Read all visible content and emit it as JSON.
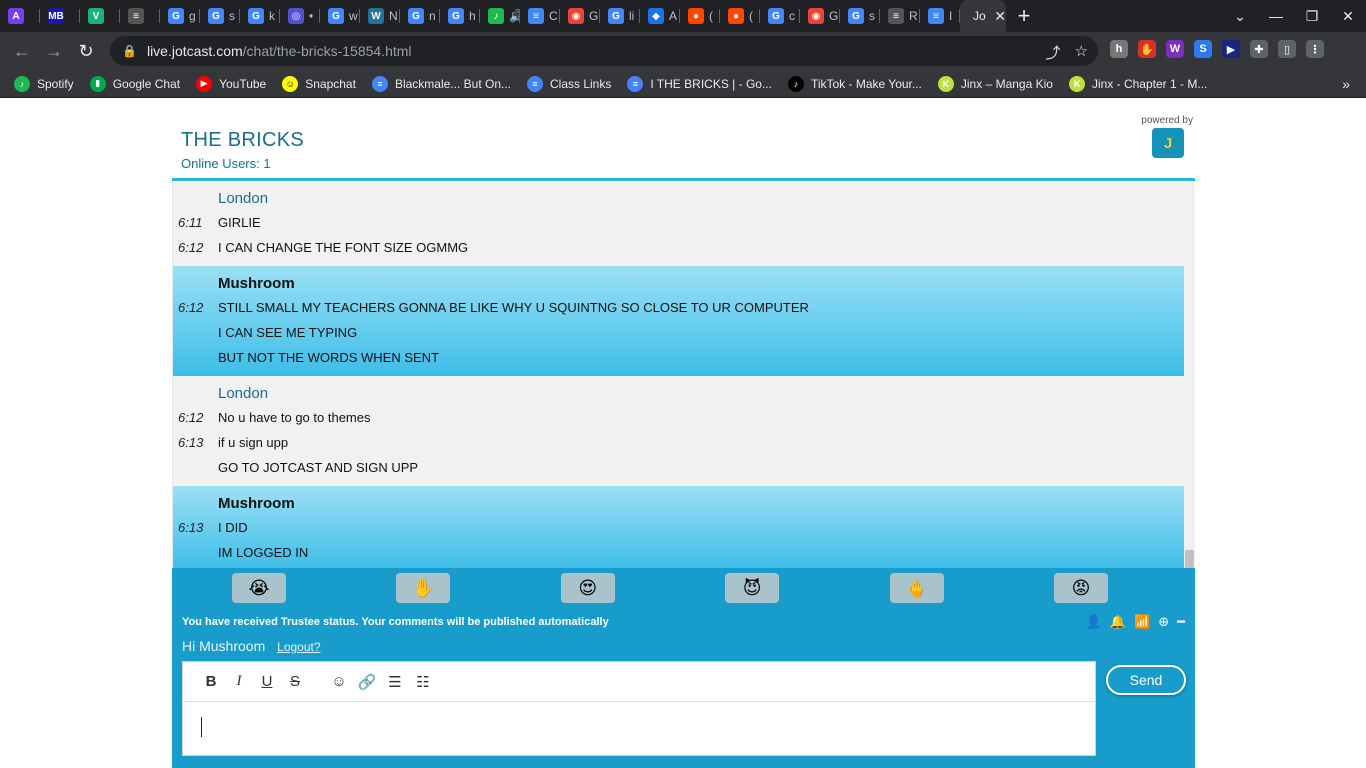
{
  "browser": {
    "tabs": [
      {
        "fav": "A",
        "color": "#7a3cf0",
        "title": ""
      },
      {
        "fav": "MB",
        "color": "#1a1aa8",
        "title": ""
      },
      {
        "fav": "V",
        "color": "#18b27a",
        "title": ""
      },
      {
        "fav": "≡",
        "color": "#555555",
        "title": ""
      },
      {
        "fav": "G",
        "color": "#4285f4",
        "title": "g"
      },
      {
        "fav": "G",
        "color": "#4285f4",
        "title": "s"
      },
      {
        "fav": "G",
        "color": "#4285f4",
        "title": "k"
      },
      {
        "fav": "◎",
        "color": "#5050d0",
        "title": "•"
      },
      {
        "fav": "G",
        "color": "#4285f4",
        "title": "w"
      },
      {
        "fav": "W",
        "color": "#21759b",
        "title": "N"
      },
      {
        "fav": "G",
        "color": "#4285f4",
        "title": "n"
      },
      {
        "fav": "G",
        "color": "#4285f4",
        "title": "h"
      },
      {
        "fav": "♪",
        "color": "#1db954",
        "title": "🔊"
      },
      {
        "fav": "≡",
        "color": "#4285f4",
        "title": "C"
      },
      {
        "fav": "◉",
        "color": "#ea4335",
        "title": "G"
      },
      {
        "fav": "G",
        "color": "#4285f4",
        "title": "li"
      },
      {
        "fav": "◆",
        "color": "#1a73e8",
        "title": "A"
      },
      {
        "fav": "●",
        "color": "#ff4500",
        "title": "("
      },
      {
        "fav": "●",
        "color": "#ff4500",
        "title": "("
      },
      {
        "fav": "G",
        "color": "#4285f4",
        "title": "c"
      },
      {
        "fav": "◉",
        "color": "#ea4335",
        "title": "G"
      },
      {
        "fav": "G",
        "color": "#4285f4",
        "title": "s"
      },
      {
        "fav": "≡",
        "color": "#555555",
        "title": "R"
      },
      {
        "fav": "≡",
        "color": "#4285f4",
        "title": "I"
      }
    ],
    "active_tab": {
      "title": "Jo",
      "close": "✕"
    },
    "new_tab": "+",
    "window_controls": {
      "dropdown": "⌄",
      "minimize": "—",
      "restore": "❐",
      "close": "✕"
    },
    "nav": {
      "back": "←",
      "forward": "→",
      "reload": "↻"
    },
    "url_host": "live.jotcast.com",
    "url_path": "/chat/the-bricks-15854.html",
    "omnibox_icons": {
      "share": "⤴",
      "star": "☆"
    },
    "extensions": [
      {
        "glyph": "h",
        "color": "#777777"
      },
      {
        "glyph": "✋",
        "color": "#d93025"
      },
      {
        "glyph": "W",
        "color": "#7b2fbe"
      },
      {
        "glyph": "S",
        "color": "#2b7bf0"
      },
      {
        "glyph": "▶",
        "color": "#1a237e"
      },
      {
        "glyph": "✚",
        "color": "#5f6368"
      },
      {
        "glyph": "▯",
        "color": "#5f6368"
      },
      {
        "glyph": "⋮",
        "color": "#5f6368"
      }
    ],
    "bookmarks": [
      {
        "label": "Spotify",
        "glyph": "♪",
        "color": "#1db954"
      },
      {
        "label": "Google Chat",
        "glyph": "▮",
        "color": "#00ac47"
      },
      {
        "label": "YouTube",
        "glyph": "▶",
        "color": "#ff0000"
      },
      {
        "label": "Snapchat",
        "glyph": "☺",
        "color": "#fffc00"
      },
      {
        "label": "Blackmale... But On...",
        "glyph": "≡",
        "color": "#4285f4"
      },
      {
        "label": "Class Links",
        "glyph": "≡",
        "color": "#4285f4"
      },
      {
        "label": "I THE BRICKS | - Go...",
        "glyph": "≡",
        "color": "#4285f4"
      },
      {
        "label": "TikTok - Make Your...",
        "glyph": "♪",
        "color": "#010101"
      },
      {
        "label": "Jinx – Manga Kio",
        "glyph": "K",
        "color": "#c0e040"
      },
      {
        "label": "Jinx - Chapter 1 - M...",
        "glyph": "K",
        "color": "#c0e040"
      }
    ],
    "bookmarks_more": "»"
  },
  "chat": {
    "title": "THE BRICKS",
    "online_users": "Online Users: 1",
    "powered_by": "powered by",
    "logo": "J",
    "groups": [
      {
        "author": "London",
        "style": "london",
        "lines": [
          {
            "time": "6:11",
            "text": "GIRLIE"
          },
          {
            "time": "6:12",
            "text": "I CAN CHANGE THE FONT SIZE OGMMG"
          }
        ]
      },
      {
        "author": "Mushroom",
        "style": "mush",
        "lines": [
          {
            "time": "6:12",
            "text": "STILL SMALL MY TEACHERS GONNA BE LIKE WHY U SQUINTNG SO CLOSE TO UR COMPUTER"
          },
          {
            "time": "",
            "text": "I CAN SEE ME TYPING"
          },
          {
            "time": "",
            "text": "BUT NOT THE WORDS WHEN SENT"
          }
        ]
      },
      {
        "author": "London",
        "style": "london",
        "lines": [
          {
            "time": "6:12",
            "text": "No u have to go to themes"
          },
          {
            "time": "6:13",
            "text": "if u sign upp"
          },
          {
            "time": "",
            "text": "GO TO JOTCAST AND SIGN UPP"
          }
        ]
      },
      {
        "author": "Mushroom",
        "style": "mush",
        "lines": [
          {
            "time": "6:13",
            "text": "I DID"
          },
          {
            "time": "",
            "text": "IM LOGGED IN"
          }
        ]
      }
    ]
  },
  "composer": {
    "emojis": [
      "😭",
      "✋",
      "😍",
      "😈",
      "🖕",
      "😡"
    ],
    "trustee_notice": "You have received Trustee status. Your comments will be published automatically",
    "status_icons": [
      "👤",
      "🔔",
      "📶",
      "⊕",
      "━"
    ],
    "greeting": "Hi Mushroom",
    "logout": "Logout?",
    "toolbar": {
      "bold": "B",
      "italic": "I",
      "underline": "U",
      "strike": "S",
      "emoji": "☺",
      "link": "🔗",
      "ordered": "☰",
      "bullet": "☷"
    },
    "send_label": "Send"
  }
}
